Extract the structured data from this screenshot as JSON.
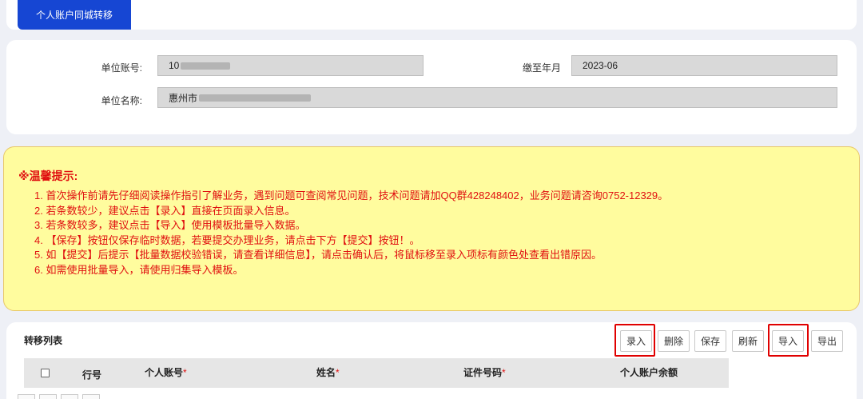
{
  "tab": {
    "label": "个人账户同城转移"
  },
  "info": {
    "unit_account_label": "单位账号:",
    "unit_account_value": "10",
    "pay_until_label": "缴至年月",
    "pay_until_value": "2023-06",
    "unit_name_label": "单位名称:",
    "unit_name_value": "惠州市"
  },
  "tips": {
    "title": "※温馨提示:",
    "items": [
      "1. 首次操作前请先仔细阅读操作指引了解业务，遇到问题可查阅常见问题，技术问题请加QQ群428248402，业务问题请咨询0752-12329。",
      "2. 若条数较少，建议点击【录入】直接在页面录入信息。",
      "3. 若条数较多，建议点击【导入】使用模板批量导入数据。",
      "4. 【保存】按钮仅保存临时数据，若要提交办理业务，请点击下方【提交】按钮！。",
      "5. 如【提交】后提示【批量数据校验错误，请查看详细信息】，请点击确认后，将鼠标移至录入项标有颜色处查看出错原因。",
      "6. 如需使用批量导入，请使用归集导入模板。"
    ]
  },
  "list": {
    "title": "转移列表",
    "buttons": {
      "enter": "录入",
      "delete": "删除",
      "save": "保存",
      "refresh": "刷新",
      "import": "导入",
      "export": "导出"
    },
    "columns": {
      "row_no": "行号",
      "personal_account": "个人账号",
      "name": "姓名",
      "id_number": "证件号码",
      "balance": "个人账户余额"
    },
    "required_mark": "*"
  },
  "colors": {
    "accent": "#1646d3",
    "tip_text": "#e01010",
    "tip_background": "#fffc9e",
    "highlight_border": "#e00000"
  }
}
